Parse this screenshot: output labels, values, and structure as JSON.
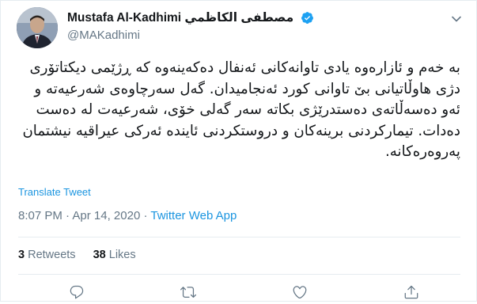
{
  "user": {
    "display_name": "Mustafa Al-Kadhimi مصطفى الكاظمي",
    "handle": "@MAKadhimi",
    "verified": true
  },
  "tweet": {
    "text": "به خەم و ئازارەوە یادی تاوانەکانی ئەنفال دەکەینەوە کە ڕژێمی دیکتاتۆری\nدژی هاوڵاتیانی بێ تاوانی کورد ئەنجامیدان. گەل سەرچاوەی شەرعیەتە و\nئەو دەسەڵاتەی دەستدرێژی بکاتە سەر گەلی خۆی، شەرعیەت لە دەست\nدەدات. تیمارکردنی برینەکان و دروستکردنی ئاینده ئەرکی عیراقیە نیشتمان\nپەروەرەکانە.",
    "translate_label": "Translate Tweet",
    "time": "8:07 PM",
    "date": "Apr 14, 2020",
    "separator": "·",
    "source": "Twitter Web App"
  },
  "stats": {
    "retweets_count": "3",
    "retweets_label": "Retweets",
    "likes_count": "38",
    "likes_label": "Likes"
  },
  "icons": {
    "verified": "verified-badge-icon",
    "menu": "chevron-down-icon",
    "reply": "reply-icon",
    "retweet": "retweet-icon",
    "like": "heart-icon",
    "share": "share-icon"
  },
  "colors": {
    "link": "#1b95e0",
    "muted": "#657786",
    "text": "#14171a",
    "border": "#e6ecf0"
  }
}
